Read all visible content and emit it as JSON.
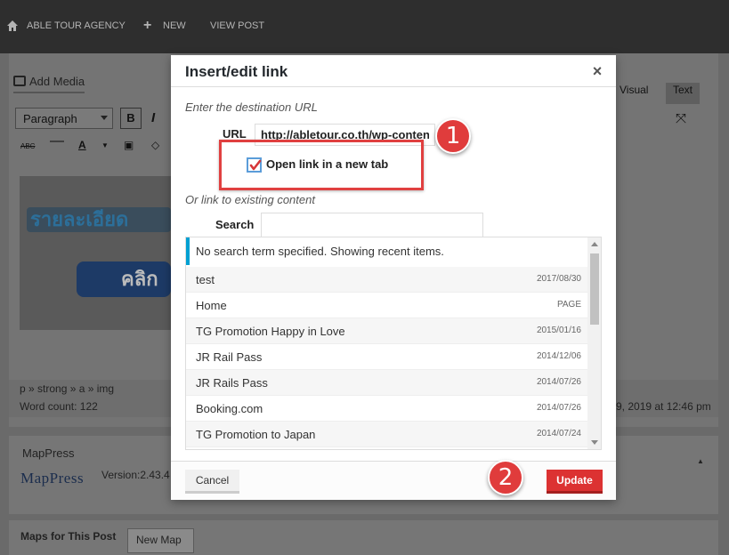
{
  "adminbar": {
    "site_name": "ABLE TOUR AGENCY",
    "new_label": "NEW",
    "view_post_label": "VIEW POST"
  },
  "editor": {
    "add_media_label": "Add Media",
    "format_select": "Paragraph",
    "bold_label": "B",
    "italic_label": "I",
    "visual_tab": "Visual",
    "text_tab": "Text",
    "strikethrough_label": "ABC",
    "text_color_label": "A",
    "breadcrumb_path": "p » strong » a » img",
    "word_count": "Word count: 122",
    "last_edited": "9, 2019 at 12:46 pm",
    "image_banner_text": "รายละเอียด",
    "image_button_text": "คลิก"
  },
  "mappress": {
    "panel_title": "MapPress",
    "logo_text": "MapPress",
    "version_text": "Version:2.43.4",
    "maps_for_post_label": "Maps for This Post",
    "new_map_button": "New Map"
  },
  "modal": {
    "title": "Insert/edit link",
    "close_label": "×",
    "destination_label": "Enter the destination URL",
    "url_label": "URL",
    "url_value": "http://abletour.co.th/wp-content",
    "open_new_tab_label": "Open link in a new tab",
    "open_new_tab_checked": true,
    "existing_content_label": "Or link to existing content",
    "search_label": "Search",
    "search_value": "",
    "query_notice": "No search term specified. Showing recent items.",
    "results": [
      {
        "title": "test",
        "info": "2017/08/30"
      },
      {
        "title": "Home",
        "info": "PAGE"
      },
      {
        "title": "TG Promotion Happy in Love",
        "info": "2015/01/16"
      },
      {
        "title": "JR Rail Pass",
        "info": "2014/12/06"
      },
      {
        "title": "JR Rails Pass",
        "info": "2014/07/26"
      },
      {
        "title": "Booking.com",
        "info": "2014/07/26"
      },
      {
        "title": "TG Promotion to Japan",
        "info": "2014/07/24"
      }
    ],
    "cancel_label": "Cancel",
    "update_label": "Update"
  },
  "annotations": {
    "badge_1": "1",
    "badge_2": "2"
  },
  "colors": {
    "accent_red": "#dc3232",
    "notice_blue": "#00a0d2",
    "checkbox_border": "#5b9dd9",
    "check_mark": "#d63638"
  },
  "icons": {
    "home": "home-icon",
    "plus": "plus-icon",
    "media": "media-icon",
    "close": "close-icon",
    "check": "check-icon",
    "fullscreen": "fullscreen-icon"
  }
}
